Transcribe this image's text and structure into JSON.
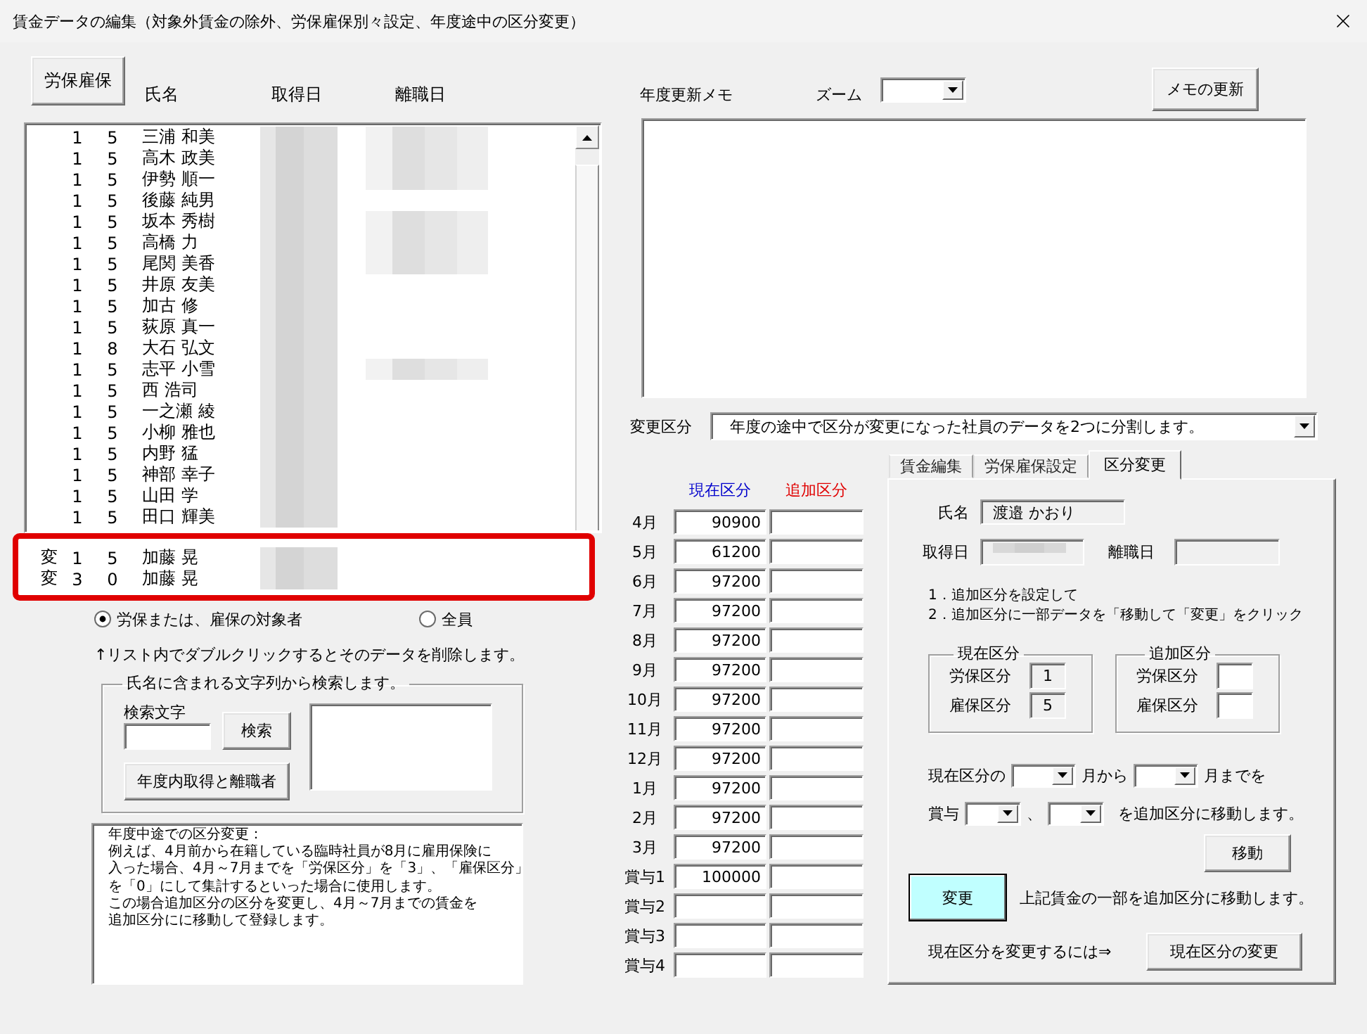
{
  "window": {
    "title": "賃金データの編集（対象外賃金の除外、労保雇保別々設定、年度途中の区分変更）"
  },
  "employee_list": {
    "header_button": "労保雇保",
    "columns": [
      "氏名",
      "取得日",
      "離職日"
    ],
    "rows": [
      {
        "column_1": "1",
        "column_2": "5",
        "name": "三浦 和美",
        "leave_date_masked": true
      },
      {
        "column_1": "1",
        "column_2": "5",
        "name": "高木 政美",
        "leave_date_masked": true
      },
      {
        "column_1": "1",
        "column_2": "5",
        "name": "伊勢 順一",
        "leave_date_masked": true
      },
      {
        "column_1": "1",
        "column_2": "5",
        "name": "後藤 純男",
        "leave_date_masked": false
      },
      {
        "column_1": "1",
        "column_2": "5",
        "name": "坂本 秀樹",
        "leave_date_masked": true
      },
      {
        "column_1": "1",
        "column_2": "5",
        "name": "高橋 力",
        "leave_date_masked": true
      },
      {
        "column_1": "1",
        "column_2": "5",
        "name": "尾関 美香",
        "leave_date_masked": true
      },
      {
        "column_1": "1",
        "column_2": "5",
        "name": "井原 友美",
        "leave_date_masked": false
      },
      {
        "column_1": "1",
        "column_2": "5",
        "name": "加古 修",
        "leave_date_masked": false
      },
      {
        "column_1": "1",
        "column_2": "5",
        "name": "荻原 真一",
        "leave_date_masked": false
      },
      {
        "column_1": "1",
        "column_2": "8",
        "name": "大石 弘文",
        "leave_date_masked": false
      },
      {
        "column_1": "1",
        "column_2": "5",
        "name": "志平 小雪",
        "leave_date_masked": true
      },
      {
        "column_1": "1",
        "column_2": "5",
        "name": "西 浩司",
        "leave_date_masked": false
      },
      {
        "column_1": "1",
        "column_2": "5",
        "name": "一之瀬 綾",
        "leave_date_masked": false
      },
      {
        "column_1": "1",
        "column_2": "5",
        "name": "小柳 雅也",
        "leave_date_masked": false
      },
      {
        "column_1": "1",
        "column_2": "5",
        "name": "内野 猛",
        "leave_date_masked": false
      },
      {
        "column_1": "1",
        "column_2": "5",
        "name": "神部 幸子",
        "leave_date_masked": false
      },
      {
        "column_1": "1",
        "column_2": "5",
        "name": "山田 学",
        "leave_date_masked": false
      },
      {
        "column_1": "1",
        "column_2": "5",
        "name": "田口 輝美",
        "leave_date_masked": false
      }
    ],
    "highlighted_rows": [
      {
        "flag": "変",
        "column_1": "1",
        "column_2": "5",
        "name": "加藤 晃",
        "leave_date_masked": false
      },
      {
        "flag": "変",
        "column_1": "3",
        "column_2": "0",
        "name": "加藤 晃",
        "leave_date_masked": false
      }
    ]
  },
  "filter": [
    {
      "label": "労保または、雇保の対象者",
      "selected": true
    },
    {
      "label": "全員",
      "selected": false
    }
  ],
  "list_note": "↑リスト内でダブルクリックするとそのデータを削除します。",
  "search": {
    "legend": "氏名に含まれる文字列から検索します。",
    "field_label": "検索文字",
    "search_button": "検索",
    "period_button": "年度内取得と離職者"
  },
  "help_lines": [
    "年度中途での区分変更：",
    "例えば、4月前から在籍している臨時社員が8月に雇用保険に",
    "入った場合、4月～7月までを「労保区分」を「3」、「雇保区分」",
    "を「0」にして集計するといった場合に使用します。",
    "この場合追加区分の区分を変更し、4月～7月までの賃金を",
    "追加区分にに移動して登録します。"
  ],
  "memo": {
    "label": "年度更新メモ",
    "zoom_label": "ズーム",
    "update_button": "メモの更新"
  },
  "change_type": {
    "label": "変更区分",
    "value": "年度の途中で区分が変更になった社員のデータを2つに分割します。"
  },
  "wage_table": {
    "columns": [
      {
        "label": "現在区分",
        "color": "#0000cc"
      },
      {
        "label": "追加区分",
        "color": "#e00000"
      }
    ],
    "rows": [
      {
        "month": "4月",
        "current": "90900"
      },
      {
        "month": "5月",
        "current": "61200"
      },
      {
        "month": "6月",
        "current": "97200"
      },
      {
        "month": "7月",
        "current": "97200"
      },
      {
        "month": "8月",
        "current": "97200"
      },
      {
        "month": "9月",
        "current": "97200"
      },
      {
        "month": "10月",
        "current": "97200"
      },
      {
        "month": "11月",
        "current": "97200"
      },
      {
        "month": "12月",
        "current": "97200"
      },
      {
        "month": "1月",
        "current": "97200"
      },
      {
        "month": "2月",
        "current": "97200"
      },
      {
        "month": "3月",
        "current": "97200"
      },
      {
        "month": "賞与1",
        "current": "100000"
      },
      {
        "month": "賞与2"
      },
      {
        "month": "賞与3"
      },
      {
        "month": "賞与4"
      }
    ]
  },
  "split_panel": {
    "tabs": [
      {
        "label": "賃金編集",
        "selected": false
      },
      {
        "label": "労保雇保設定",
        "selected": false
      },
      {
        "label": "区分変更",
        "selected": true
      }
    ],
    "name_label": "氏名",
    "name_value": "渡邉 かおり",
    "acquired_label": "取得日",
    "left_label": "離職日",
    "steps": [
      "1．追加区分を設定して",
      "2．追加区分に一部データを「移動して「変更」をクリック"
    ],
    "groups": [
      {
        "legend": "現在区分",
        "disabled": true,
        "fields": [
          {
            "label": "労保区分",
            "value": "1"
          },
          {
            "label": "雇保区分",
            "value": "5"
          }
        ]
      },
      {
        "legend": "追加区分",
        "disabled": false,
        "fields": [
          {
            "label": "労保区分"
          },
          {
            "label": "雇保区分"
          }
        ]
      }
    ],
    "month_range": {
      "prefix": "現在区分の",
      "from_suffix": "月から",
      "to_suffix": "月までを"
    },
    "bonus_range": {
      "prefix": "賞与",
      "separator": "、",
      "suffix": "を追加区分に移動します。"
    },
    "move_button": "移動",
    "change_button": "変更",
    "change_note": "上記賃金の一部を追加区分に移動します。",
    "current_change_note": "現在区分を変更するには⇒",
    "current_change_button": "現在区分の変更"
  }
}
